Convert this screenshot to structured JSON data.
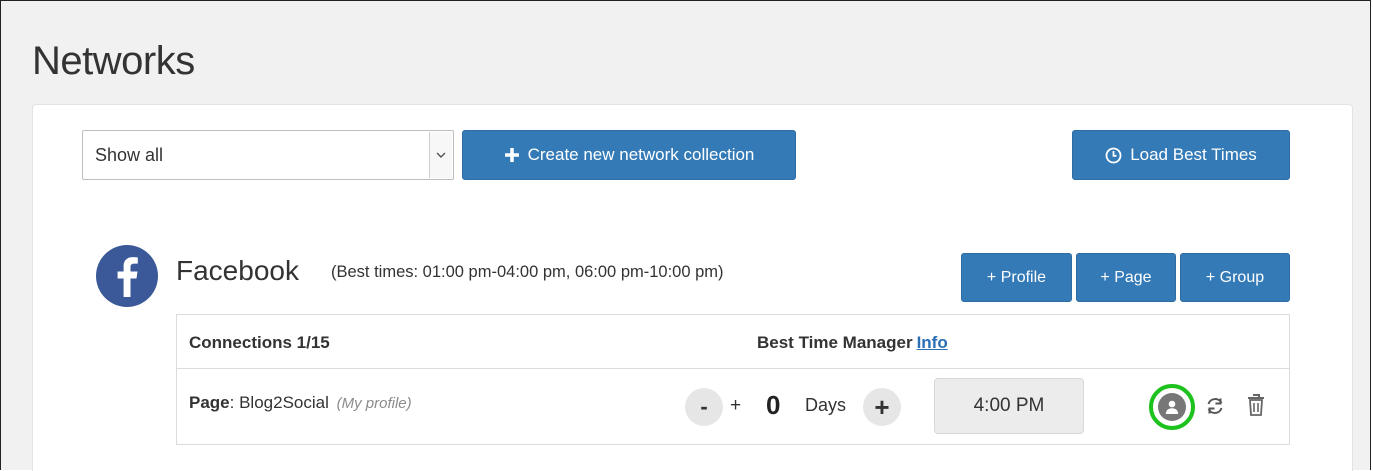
{
  "page": {
    "title": "Networks"
  },
  "filter": {
    "selected": "Show all"
  },
  "toolbar": {
    "create_label": "Create new network collection",
    "load_label": "Load Best Times"
  },
  "network": {
    "name": "Facebook",
    "best_times": "(Best times: 01:00 pm-04:00 pm, 06:00 pm-10:00 pm)",
    "add_profile": "+ Profile",
    "add_page": "+ Page",
    "add_group": "+ Group"
  },
  "table": {
    "connections_label": "Connections 1/15",
    "best_time_manager_label": "Best Time Manager",
    "info_link": "Info",
    "rows": [
      {
        "type": "Page",
        "name": ": Blog2Social",
        "note": "(My profile)",
        "minus": "-",
        "plus_sign": "+",
        "days": "0",
        "days_label": "Days",
        "plus": "+",
        "time": "4:00 PM"
      }
    ]
  },
  "colors": {
    "primary": "#337ab7",
    "highlight": "#1ec21e",
    "facebook": "#3b5998"
  },
  "icons": [
    "chevron-down-icon",
    "plus-icon",
    "clock-icon",
    "facebook-icon",
    "user-icon",
    "refresh-icon",
    "trash-icon"
  ]
}
